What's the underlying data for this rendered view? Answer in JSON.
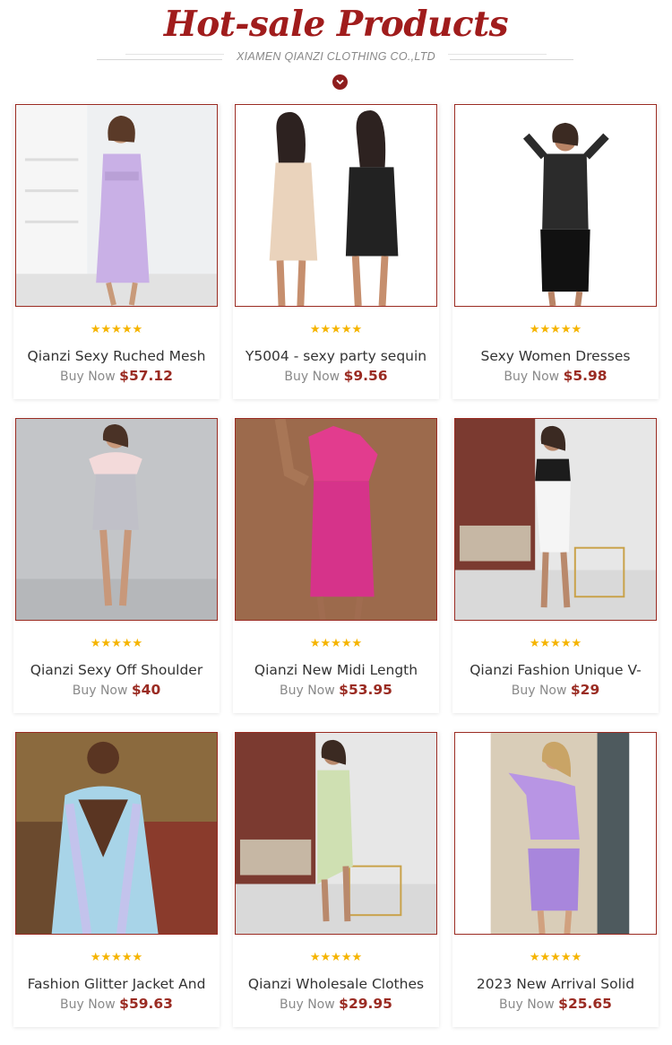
{
  "header": {
    "title": "Hot-sale Products",
    "subtitle": "XIAMEN QIANZI CLOTHING CO.,LTD",
    "scroll_icon": "chevron-down-icon"
  },
  "colors": {
    "accent": "#a01c1c",
    "price": "#9a2b22",
    "star": "#f5b400"
  },
  "products": [
    {
      "name": "Qianzi Sexy Ruched Mesh",
      "buy_label": "Buy Now",
      "price": "$57.12",
      "rating": 5,
      "stars": "★★★★★"
    },
    {
      "name": "Y5004 - sexy party sequin",
      "buy_label": "Buy Now",
      "price": "$9.56",
      "rating": 5,
      "stars": "★★★★★"
    },
    {
      "name": "Sexy Women Dresses",
      "buy_label": "Buy Now",
      "price": "$5.98",
      "rating": 5,
      "stars": "★★★★★"
    },
    {
      "name": "Qianzi Sexy Off Shoulder",
      "buy_label": "Buy Now",
      "price": "$40",
      "rating": 5,
      "stars": "★★★★★"
    },
    {
      "name": "Qianzi New Midi Length",
      "buy_label": "Buy Now",
      "price": "$53.95",
      "rating": 5,
      "stars": "★★★★★"
    },
    {
      "name": "Qianzi Fashion Unique V-",
      "buy_label": "Buy Now",
      "price": "$29",
      "rating": 5,
      "stars": "★★★★★"
    },
    {
      "name": "Fashion Glitter Jacket And",
      "buy_label": "Buy Now",
      "price": "$59.63",
      "rating": 5,
      "stars": "★★★★★"
    },
    {
      "name": "Qianzi Wholesale Clothes",
      "buy_label": "Buy Now",
      "price": "$29.95",
      "rating": 5,
      "stars": "★★★★★"
    },
    {
      "name": "2023 New Arrival Solid",
      "buy_label": "Buy Now",
      "price": "$25.65",
      "rating": 5,
      "stars": "★★★★★"
    }
  ]
}
